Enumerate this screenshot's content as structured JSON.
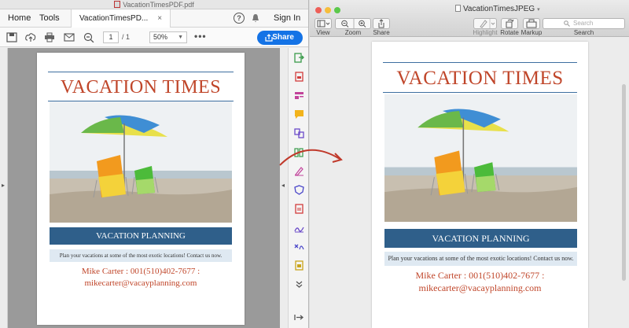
{
  "acrobat": {
    "window_title": "VacationTimesPDF.pdf",
    "tabs": {
      "home": "Home",
      "tools": "Tools",
      "document_tab": "VacationTimesPD...",
      "close_glyph": "×"
    },
    "help_glyph": "?",
    "sign_in": "Sign In",
    "page": {
      "current": "1",
      "total": "/ 1"
    },
    "zoom": "50%",
    "more_glyph": "•••",
    "share_label": "Share"
  },
  "preview": {
    "window_title": "VacationTimesJPEG",
    "toolbar": {
      "view": "View",
      "zoom": "Zoom",
      "share": "Share",
      "highlight": "Highlight",
      "rotate": "Rotate",
      "markup": "Markup",
      "search": "Search",
      "search_placeholder": "Search"
    }
  },
  "document": {
    "title": "VACATION TIMES",
    "band": "VACATION PLANNING",
    "info": "Plan your vacations at some of the most exotic locations! Contact us now.",
    "contact_line1": "Mike Carter : 001(510)402-7677 :",
    "contact_line2": "mikecarter@vacayplanning.com"
  },
  "colors": {
    "accent": "#1473e6",
    "title_red": "#c0462a",
    "band_blue": "#2f5f8a",
    "info_bg": "#dfe9f2",
    "arrow": "#c0392b"
  },
  "icons": [
    "save-icon",
    "upload-icon",
    "print-icon",
    "mail-icon",
    "zoom-out-icon",
    "bell-icon",
    "share-icon",
    "export-pdf-icon",
    "create-pdf-icon",
    "edit-pdf-icon",
    "comment-icon",
    "combine-icon",
    "organize-icon",
    "fill-sign-icon",
    "protect-icon",
    "compress-icon",
    "sign-icon",
    "measure-icon",
    "stamp-icon",
    "expand-icon",
    "sidebar-icon",
    "zoom-in-icon",
    "pen-icon",
    "rotate-icon",
    "markup-icon",
    "search-icon",
    "arrow-icon"
  ]
}
